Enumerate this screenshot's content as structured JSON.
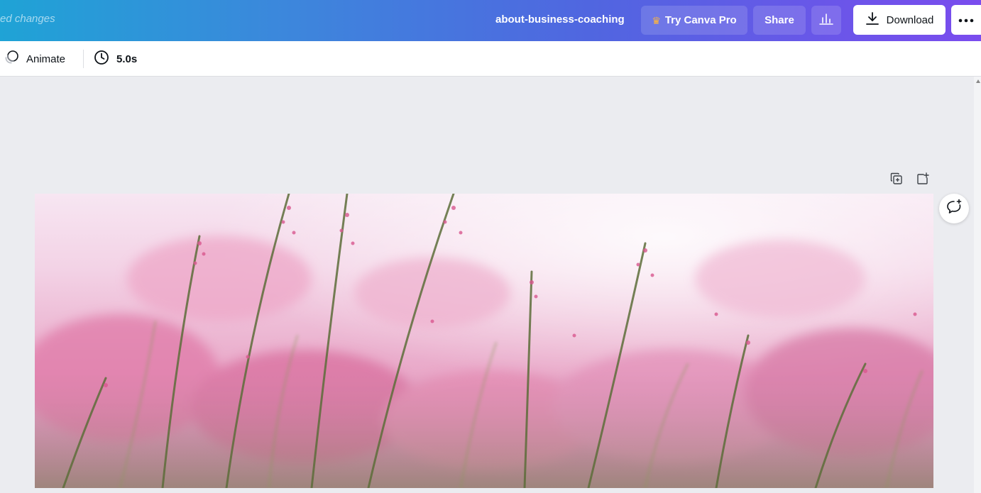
{
  "header": {
    "saved_status": "ed changes",
    "doc_title": "about-business-coaching",
    "try_pro_label": "Try Canva Pro",
    "share_label": "Share",
    "download_label": "Download"
  },
  "toolbar": {
    "animate_label": "Animate",
    "duration_label": "5.0s"
  },
  "icons": {
    "crown": "crown-icon",
    "insights": "bar-chart-icon",
    "download": "download-icon",
    "more": "more-horizontal-icon",
    "animate": "animate-icon",
    "duration": "clock-icon",
    "duplicate_page": "duplicate-page-icon",
    "add_page": "add-page-icon",
    "add_comment": "add-comment-icon"
  },
  "colors": {
    "header_gradient_start": "#1fa3d6",
    "header_gradient_end": "#7a4cee",
    "crown": "#ffb53a",
    "canvas_bg": "#ebecf0"
  },
  "canvas": {
    "page_image": "pink grass flower field photo"
  }
}
